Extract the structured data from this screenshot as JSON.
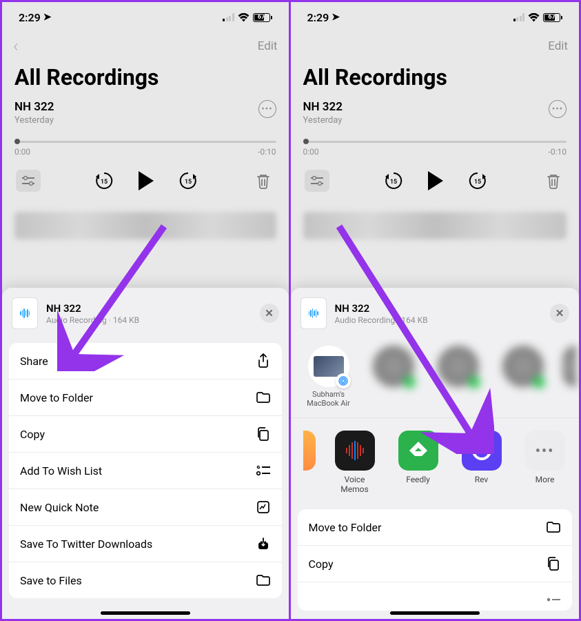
{
  "status": {
    "time": "2:29",
    "battery": "67"
  },
  "nav": {
    "edit": "Edit"
  },
  "title": "All Recordings",
  "recording": {
    "name": "NH 322",
    "date": "Yesterday",
    "t_start": "0:00",
    "t_end": "-0:10"
  },
  "sheet": {
    "file_name": "NH 322",
    "file_meta": "Audio Recording · 164 KB"
  },
  "left_menu": {
    "share": "Share",
    "move": "Move to Folder",
    "copy": "Copy",
    "wish": "Add To Wish List",
    "quick": "New Quick Note",
    "twitter": "Save To Twitter Downloads",
    "files": "Save to Files"
  },
  "airdrop": {
    "device1": "Subham's MacBook Air"
  },
  "apps": {
    "vm": "Voice Memos",
    "feedly": "Feedly",
    "rev": "Rev",
    "more": "More"
  },
  "right_menu": {
    "move": "Move to Folder",
    "copy": "Copy"
  }
}
